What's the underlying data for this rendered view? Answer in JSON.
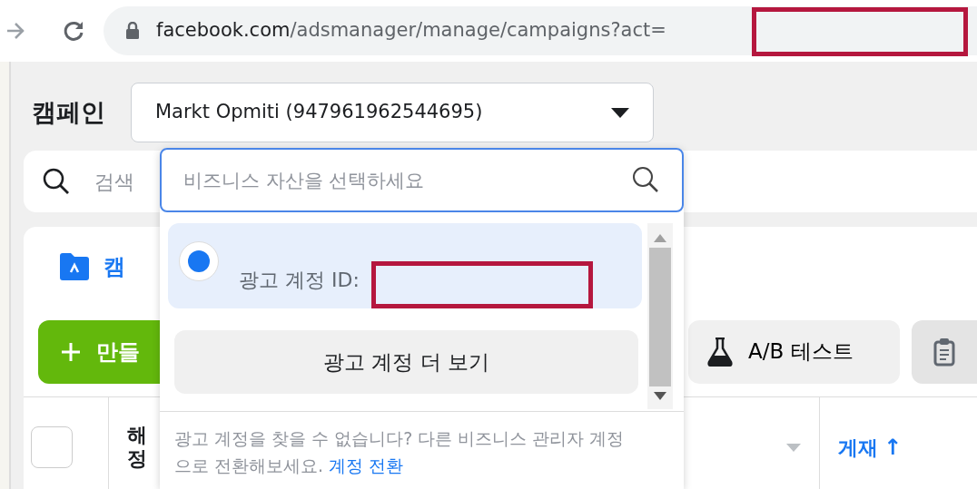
{
  "browser": {
    "url_host": "facebook.com",
    "url_path": "/adsmanager/manage/campaigns?act="
  },
  "header": {
    "title": "캠페인",
    "account_select": "Markt Opmiti (947961962544695)"
  },
  "search": {
    "placeholder": "검색"
  },
  "tabs": [
    {
      "label": "캠",
      "selected": true
    }
  ],
  "toolbar": {
    "create_label": "만들",
    "ab_test_label": "A/B 테스트"
  },
  "table": {
    "select_all_checked": false,
    "columns": [
      {
        "lines": [
          "해",
          "정"
        ]
      },
      {
        "label": "게재",
        "sort_arrow": "↑"
      }
    ]
  },
  "dropdown": {
    "placeholder": "비즈니스 자산을 선택하세요",
    "options": [
      {
        "label": "광고 계정 ID:",
        "selected": true
      }
    ],
    "more_button": "광고 계정 더 보기",
    "footer": "광고 계정을 찾을 수 없습니다? 다른 비즈니스 관리자 계정으로 전환해보세요.",
    "footer_link": "계정 전환"
  }
}
